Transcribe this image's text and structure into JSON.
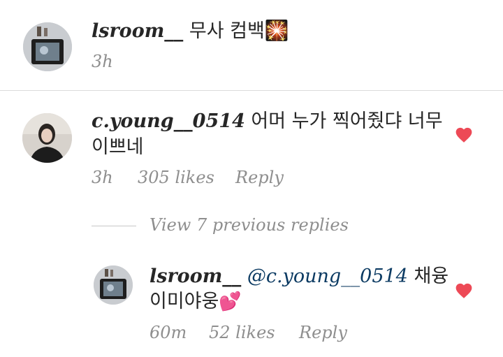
{
  "caption": {
    "username": "lsroom__",
    "text": "무사 컴백",
    "emoji": "🎇",
    "time": "3h"
  },
  "comment": {
    "username": "c.young__0514",
    "text_line1": "어머 누가 찍어줬댜 너무",
    "text_line2": "이쁘네",
    "time": "3h",
    "likes": "305 likes",
    "reply": "Reply"
  },
  "view_replies": "View 7 previous replies",
  "reply": {
    "username": "lsroom__",
    "mention": "@c.young__0514",
    "text_line1_after": "채융",
    "text_line2": "이미야웅",
    "emoji": "💕",
    "time": "60m",
    "likes": "52 likes",
    "reply": "Reply"
  },
  "colors": {
    "heart": "#ed4956",
    "mention": "#0b3a62",
    "meta": "#8e8e8e"
  },
  "icons": {
    "like": "heart-icon"
  }
}
